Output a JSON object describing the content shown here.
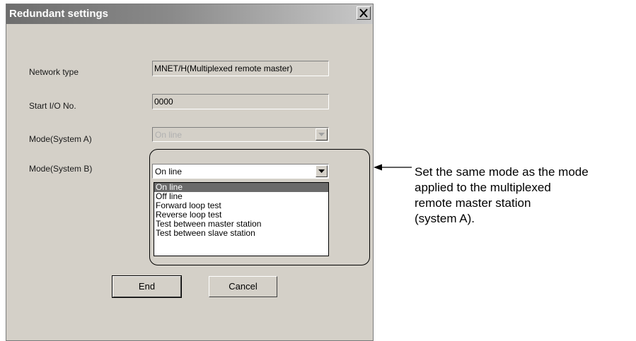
{
  "dialog": {
    "title": "Redundant settings",
    "close_icon": "close-icon"
  },
  "fields": {
    "network_type": {
      "label": "Network type",
      "value": "MNET/H(Multiplexed remote master)"
    },
    "start_io": {
      "label": "Start I/O No.",
      "value": "0000"
    },
    "mode_a": {
      "label": "Mode(System A)",
      "value": "On line"
    },
    "mode_b": {
      "label": "Mode(System B)",
      "value": "On line"
    }
  },
  "mode_b_options": [
    "On line",
    "Off line",
    "Forward loop test",
    "Reverse loop test",
    "Test between master station",
    "Test between slave station"
  ],
  "buttons": {
    "end": "End",
    "cancel": "Cancel"
  },
  "annotation": {
    "lines": [
      "Set the same mode as the mode",
      "applied to the multiplexed",
      "remote master station",
      "(system A)."
    ]
  },
  "colors": {
    "dialog_bg": "#d4d0c8",
    "title_gradient_start": "#6e6e6e",
    "selected_item_bg": "#6a6a6a"
  }
}
